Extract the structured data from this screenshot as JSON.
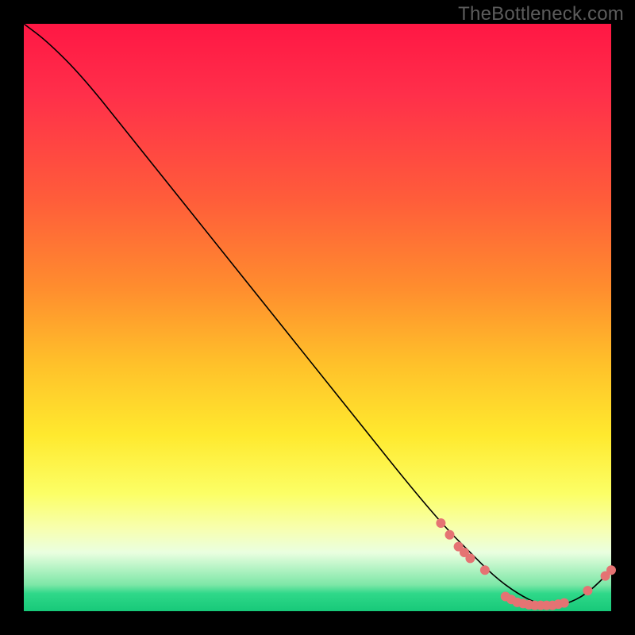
{
  "watermark": "TheBottleneck.com",
  "colors": {
    "background": "#000000",
    "curve": "#000000",
    "marker": "#e57373",
    "gradient_top": "#ff1744",
    "gradient_bottom": "#17c979"
  },
  "chart_data": {
    "type": "line",
    "title": "",
    "xlabel": "",
    "ylabel": "",
    "xlim": [
      0,
      100
    ],
    "ylim": [
      0,
      100
    ],
    "x": [
      0,
      4,
      10,
      18,
      26,
      34,
      42,
      50,
      58,
      66,
      72,
      76,
      80,
      84,
      88,
      92,
      96,
      100
    ],
    "values": [
      100,
      97,
      91,
      81,
      71,
      61,
      51,
      41,
      31,
      21,
      14,
      10,
      6,
      3,
      1,
      1,
      3,
      7
    ],
    "markers": [
      {
        "x": 71,
        "y": 15
      },
      {
        "x": 72.5,
        "y": 13
      },
      {
        "x": 74,
        "y": 11
      },
      {
        "x": 75,
        "y": 10
      },
      {
        "x": 76,
        "y": 9
      },
      {
        "x": 78.5,
        "y": 7
      },
      {
        "x": 82,
        "y": 2.5
      },
      {
        "x": 83,
        "y": 2
      },
      {
        "x": 84,
        "y": 1.5
      },
      {
        "x": 85,
        "y": 1.3
      },
      {
        "x": 86,
        "y": 1.1
      },
      {
        "x": 87,
        "y": 1
      },
      {
        "x": 88,
        "y": 1
      },
      {
        "x": 89,
        "y": 1
      },
      {
        "x": 90,
        "y": 1
      },
      {
        "x": 91,
        "y": 1.2
      },
      {
        "x": 92,
        "y": 1.4
      },
      {
        "x": 96,
        "y": 3.5
      },
      {
        "x": 99,
        "y": 6
      },
      {
        "x": 100,
        "y": 7
      }
    ]
  }
}
